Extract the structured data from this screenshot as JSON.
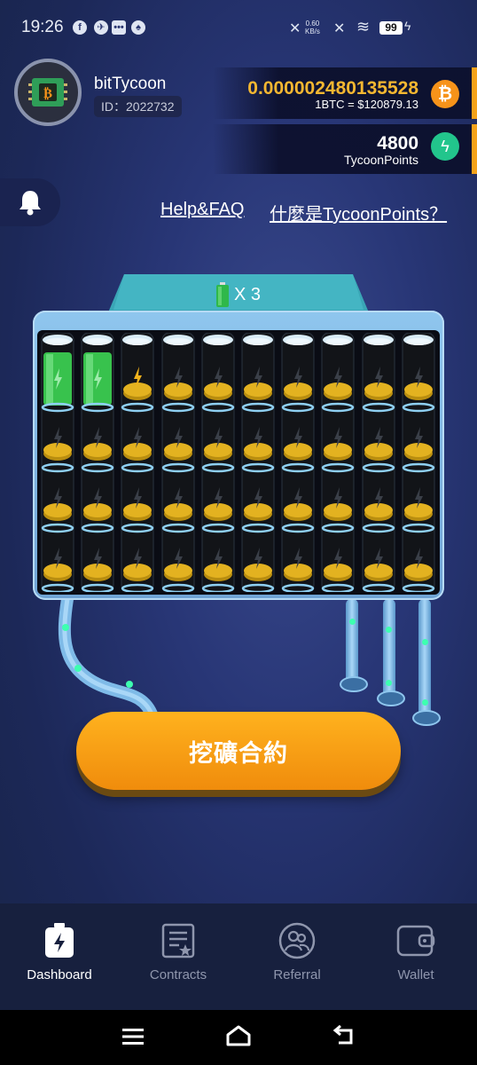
{
  "status": {
    "time": "19:26",
    "net_speed": "0.60",
    "net_unit": "KB/s",
    "battery": "99",
    "fb": "f",
    "tg": "✈",
    "msg": "•••",
    "qq": "♠",
    "mute": "✕",
    "wifi": "≋",
    "signal": "▾",
    "bolt": "ϟ"
  },
  "user": {
    "name": "bitTycoon",
    "id": "ID：2022732"
  },
  "balance": {
    "btc": "0.000002480135528",
    "rate": "1BTC = $120879.13",
    "btc_symbol": "₿",
    "points": "4800",
    "points_label": "TycoonPoints",
    "points_symbol": "ϟ"
  },
  "links": {
    "help": "Help&FAQ",
    "what_is": "什麼是TycoonPoints？"
  },
  "machine": {
    "multiplier": "X 3",
    "columns": 10,
    "charged_full": 2,
    "charging_index": 2
  },
  "cta": {
    "label": "挖礦合約"
  },
  "nav": {
    "items": [
      {
        "label": "Dashboard",
        "icon": "battery-charge-icon",
        "active": true
      },
      {
        "label": "Contracts",
        "icon": "contract-icon",
        "active": false
      },
      {
        "label": "Referral",
        "icon": "referral-icon",
        "active": false
      },
      {
        "label": "Wallet",
        "icon": "wallet-icon",
        "active": false
      }
    ]
  },
  "colors": {
    "accent": "#f4b731",
    "cta": "#f5a012",
    "points": "#22c58c",
    "btc": "#f7931a"
  }
}
